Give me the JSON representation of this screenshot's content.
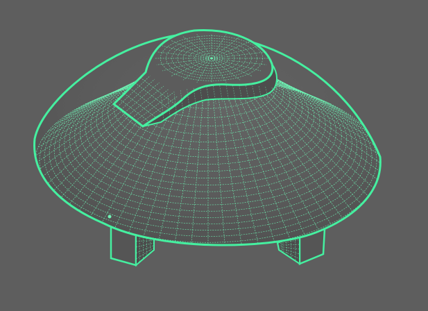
{
  "viewport": {
    "background_color": "#5e5e5e"
  },
  "model": {
    "object_type": "dome-body-with-handle-and-legs",
    "display_mode": "wireframe-on-shaded",
    "selection_state": "selected",
    "wire_color": "#45f0a0",
    "wire_dense_color": "#6ff5b5",
    "surface_color": "#5a5a5a",
    "surface_shade_color": "#515151"
  }
}
